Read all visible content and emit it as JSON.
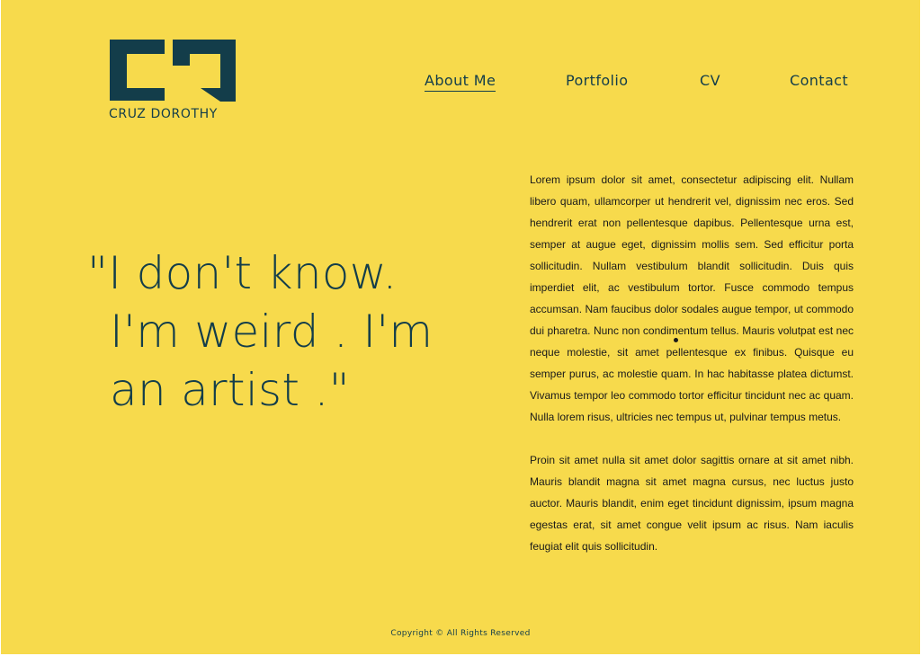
{
  "brand": {
    "name": "CRUZ DOROTHY",
    "logo_icon": "cd-monogram-icon",
    "color": "#133d4a"
  },
  "colors": {
    "background": "#f7da4c",
    "primary": "#133d4a",
    "text": "#1a1a1a"
  },
  "nav": {
    "items": [
      {
        "label": "About Me",
        "active": true
      },
      {
        "label": "Portfolio",
        "active": false
      },
      {
        "label": "CV",
        "active": false
      },
      {
        "label": "Contact",
        "active": false
      }
    ]
  },
  "quote": {
    "lines": [
      "\"I don't know.",
      "I'm weird . I'm",
      "an artist .\""
    ]
  },
  "about": {
    "paragraphs": [
      "Lorem ipsum dolor sit amet, consectetur adipiscing elit. Nullam libero quam, ullamcorper ut hendrerit vel, dignissim nec eros. Sed hendrerit erat non pellentesque dapibus. Pellentesque urna est, semper at augue eget, dignissim mollis sem. Sed efficitur porta sollicitudin. Nullam vestibulum blandit sollicitudin. Duis quis imperdiet elit, ac vestibulum tortor. Fusce commodo tempus accumsan. Nam faucibus dolor sodales augue tempor, ut commodo dui pharetra. Nunc non condimentum tellus. Mauris volutpat est nec neque molestie, sit amet pellentesque ex finibus. Quisque eu semper purus, ac molestie quam. In hac habitasse platea dictumst. Vivamus tempor leo commodo tortor efficitur tincidunt nec ac quam. Nulla lorem risus, ultricies nec tempus ut, pulvinar tempus metus.",
      "Proin sit amet nulla sit amet dolor sagittis ornare at sit amet nibh. Mauris blandit magna sit amet magna cursus, nec luctus justo auctor. Mauris blandit, enim eget tincidunt dignissim, ipsum magna egestas erat, sit amet congue velit ipsum ac risus. Nam iaculis feugiat elit quis sollicitudin."
    ]
  },
  "footer": {
    "copyright": "Copyright © All Rights Reserved"
  }
}
